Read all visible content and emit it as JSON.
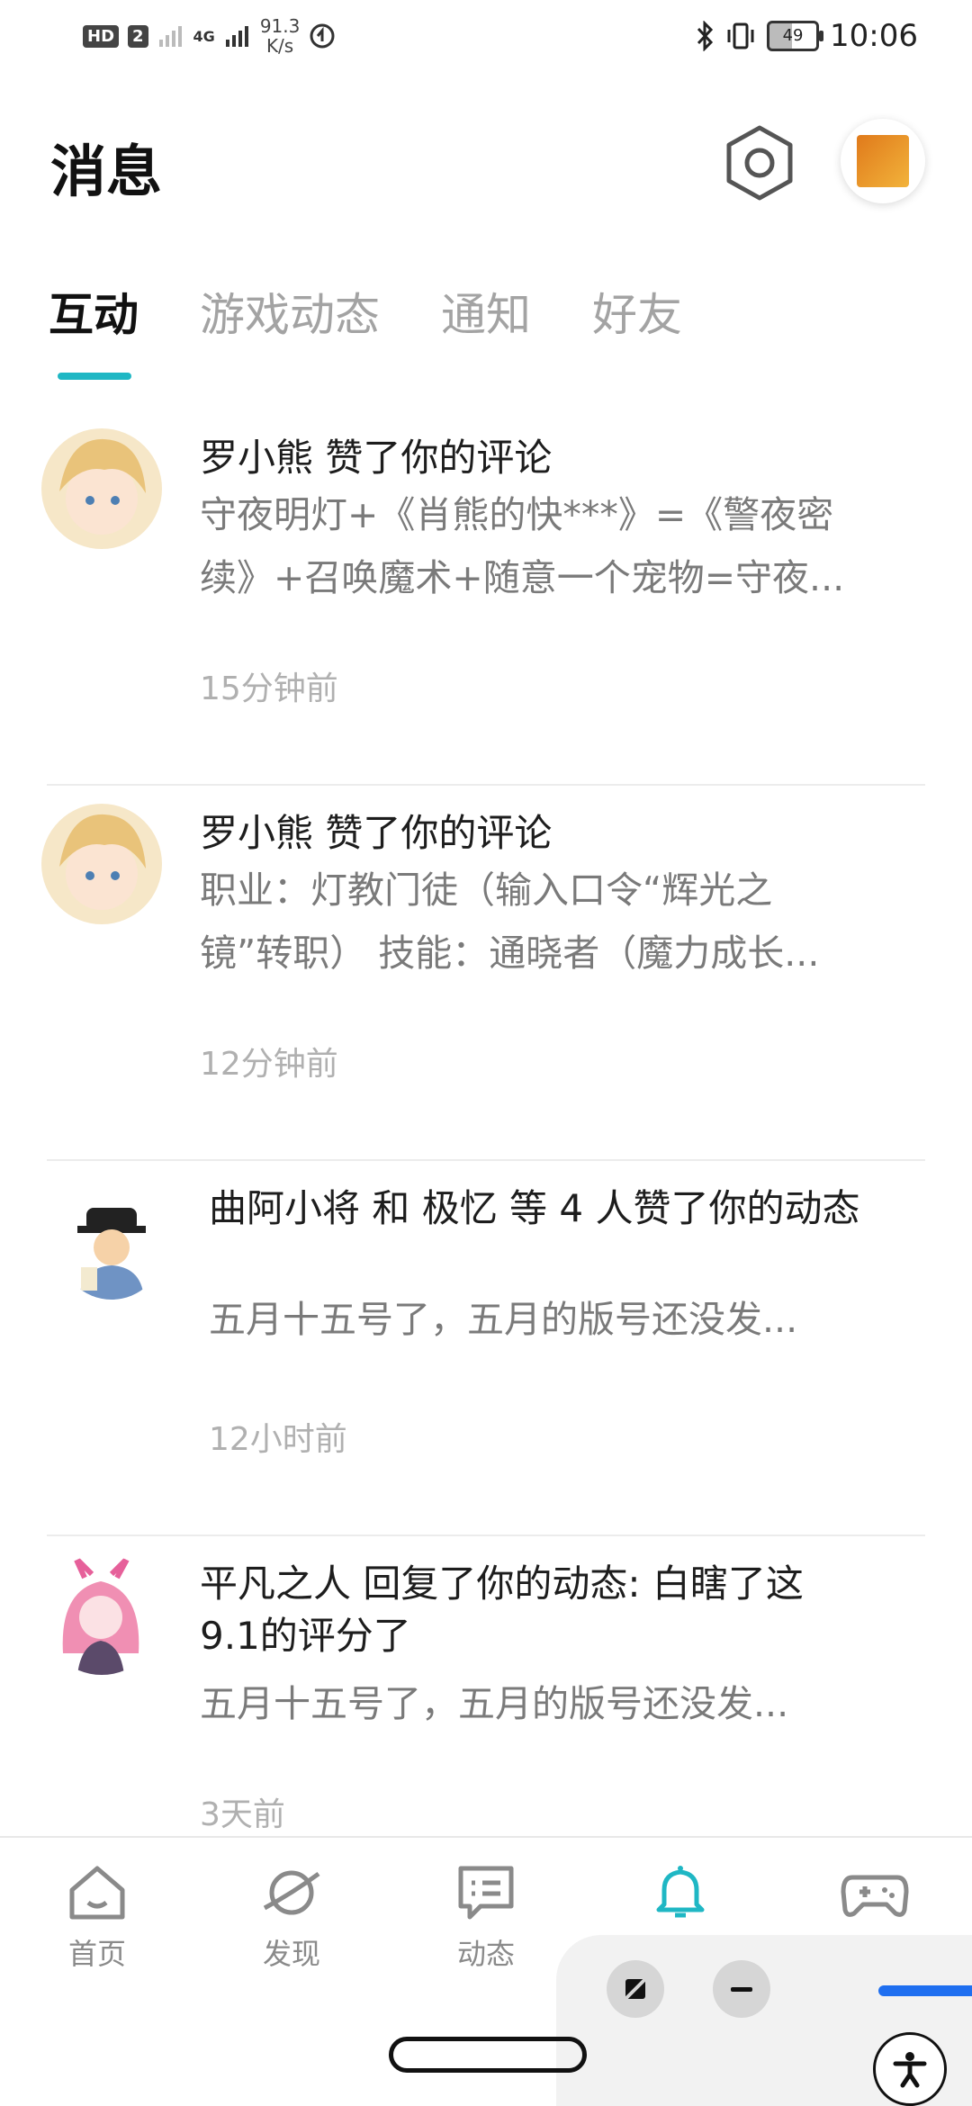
{
  "status_bar": {
    "badges": [
      "HD",
      "2"
    ],
    "network": "4G",
    "speed_value": "91.3",
    "speed_unit": "K/s",
    "battery": "49",
    "time": "10:06"
  },
  "header": {
    "title": "消息"
  },
  "tabs": [
    {
      "label": "互动",
      "active": true
    },
    {
      "label": "游戏动态",
      "active": false
    },
    {
      "label": "通知",
      "active": false
    },
    {
      "label": "好友",
      "active": false
    }
  ],
  "messages": [
    {
      "title": "罗小熊 赞了你的评论",
      "snippet_line1": "守夜明灯+《肖熊的快***》=《警夜密",
      "snippet_line2": "续》+召唤魔术+随意一个宠物=守夜...",
      "time": "15分钟前"
    },
    {
      "title": "罗小熊 赞了你的评论",
      "snippet_line1": "职业：灯教门徒（输入口令“辉光之",
      "snippet_line2": "镜”转职） 技能：通晓者（魔力成长...",
      "time": "12分钟前"
    },
    {
      "title": "曲阿小将 和 极忆 等 4 人赞了你的动态",
      "snippet_line1": "五月十五号了，五月的版号还没发...",
      "time": "12小时前"
    },
    {
      "title_line1": "平凡之人 回复了你的动态: 白瞎了这",
      "title_line2": "9.1的评分了",
      "snippet_line1": "五月十五号了，五月的版号还没发...",
      "time": "3天前"
    }
  ],
  "bottom_nav": [
    {
      "label": "首页",
      "icon": "home-icon"
    },
    {
      "label": "发现",
      "icon": "planet-icon"
    },
    {
      "label": "动态",
      "icon": "chat-icon"
    },
    {
      "label": "",
      "icon": "bell-icon",
      "active": true
    },
    {
      "label": "",
      "icon": "gamepad-icon"
    }
  ],
  "colors": {
    "accent": "#1fb7c4",
    "text": "#1d1d1d",
    "muted": "#7a7a7a",
    "time": "#b0b0b0"
  }
}
